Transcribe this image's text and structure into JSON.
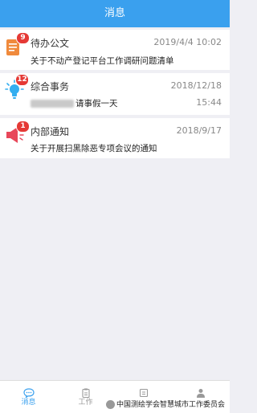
{
  "header": {
    "title": "消息"
  },
  "messages": [
    {
      "icon": "document-icon",
      "badge": "9",
      "title": "待办公文",
      "date": "2019/4/4 10:02",
      "subtitle": "关于不动产登记平台工作调研问题清单"
    },
    {
      "icon": "lightbulb-icon",
      "badge": "12",
      "title": "综合事务",
      "date": "2018/12/18",
      "time": "15:44",
      "subtitle": "请事假一天"
    },
    {
      "icon": "megaphone-icon",
      "badge": "1",
      "title": "内部通知",
      "date": "2018/9/17",
      "subtitle": "关于开展扫黑除恶专项会议的通知"
    }
  ],
  "tabbar": {
    "tabs": [
      {
        "label": "消息",
        "active": true
      },
      {
        "label": "工作"
      },
      {
        "label": ""
      },
      {
        "label": ""
      }
    ]
  },
  "watermark": {
    "text": "中国测绘学会智慧城市工作委员会"
  },
  "colors": {
    "accent": "#3aa0ee",
    "badge": "#e53935",
    "document_icon": "#f08a3c",
    "lightbulb_icon": "#33aef0",
    "megaphone_icon": "#e8475a"
  }
}
